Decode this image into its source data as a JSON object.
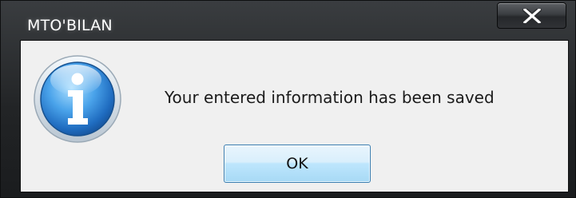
{
  "window": {
    "title": "MTO'BILAN",
    "close_icon": "close-icon"
  },
  "dialog": {
    "icon": "info-icon",
    "message": "Your entered information has been saved",
    "ok_label": "OK"
  },
  "colors": {
    "title_bar": "#222426",
    "content_background": "#f0f0f0",
    "info_icon_blue": "#2f7fd0",
    "ok_button_border": "#3c7fb1",
    "ok_button_fill": "#bee6fd"
  }
}
